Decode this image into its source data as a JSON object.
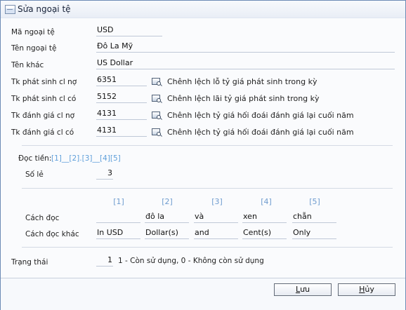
{
  "window": {
    "title": "Sửa ngoại tệ"
  },
  "form": {
    "ma_ngoai_te": {
      "label": "Mã ngoại tệ",
      "value": "USD"
    },
    "ten_ngoai_te": {
      "label": "Tên ngoại tệ",
      "value": "Đô La Mỹ"
    },
    "ten_khac": {
      "label": "Tên khác",
      "value": "US Dollar"
    },
    "accounts": [
      {
        "label": "Tk phát sinh cl nợ",
        "value": "6351",
        "description": "Chênh lệch lỗ tỷ giá phát sinh trong kỳ"
      },
      {
        "label": "Tk phát sinh cl có",
        "value": "5152",
        "description": "Chênh lệch lãi tỷ giá phát sinh trong kỳ"
      },
      {
        "label": "Tk đánh giá cl nợ",
        "value": "4131",
        "description": "Chênh lệch tỷ giá hối đoái đánh giá lại cuối năm"
      },
      {
        "label": "Tk đánh giá cl có",
        "value": "4131",
        "description": "Chênh lệch tỷ giá hối đoái đánh giá lại cuối năm"
      }
    ],
    "doc_tien": {
      "label": "Đọc tiền:",
      "pattern": [
        "[1]",
        "__",
        "[2]",
        ".",
        "[3]",
        "__",
        "[4]",
        "[5]"
      ]
    },
    "so_le": {
      "label": "Số lẻ",
      "value": "3"
    },
    "columns": [
      "[1]",
      "[2]",
      "[3]",
      "[4]",
      "[5]"
    ],
    "cach_doc": {
      "label": "Cách đọc",
      "values": [
        "",
        "đô la",
        "và",
        "xen",
        "chẵn"
      ]
    },
    "cach_doc_khac": {
      "label": "Cách đọc khác",
      "values": [
        "In USD",
        "Dollar(s)",
        "and",
        "Cent(s)",
        "Only"
      ]
    },
    "trang_thai": {
      "label": "Trạng thái",
      "value": "1",
      "hint": "1 - Còn sử dụng, 0 - Không còn sử dụng"
    }
  },
  "buttons": {
    "save": {
      "label_prefix": "",
      "underlined": "L",
      "label_suffix": "ưu"
    },
    "cancel": {
      "label_prefix": "",
      "underlined": "H",
      "label_suffix": "ủy"
    }
  }
}
